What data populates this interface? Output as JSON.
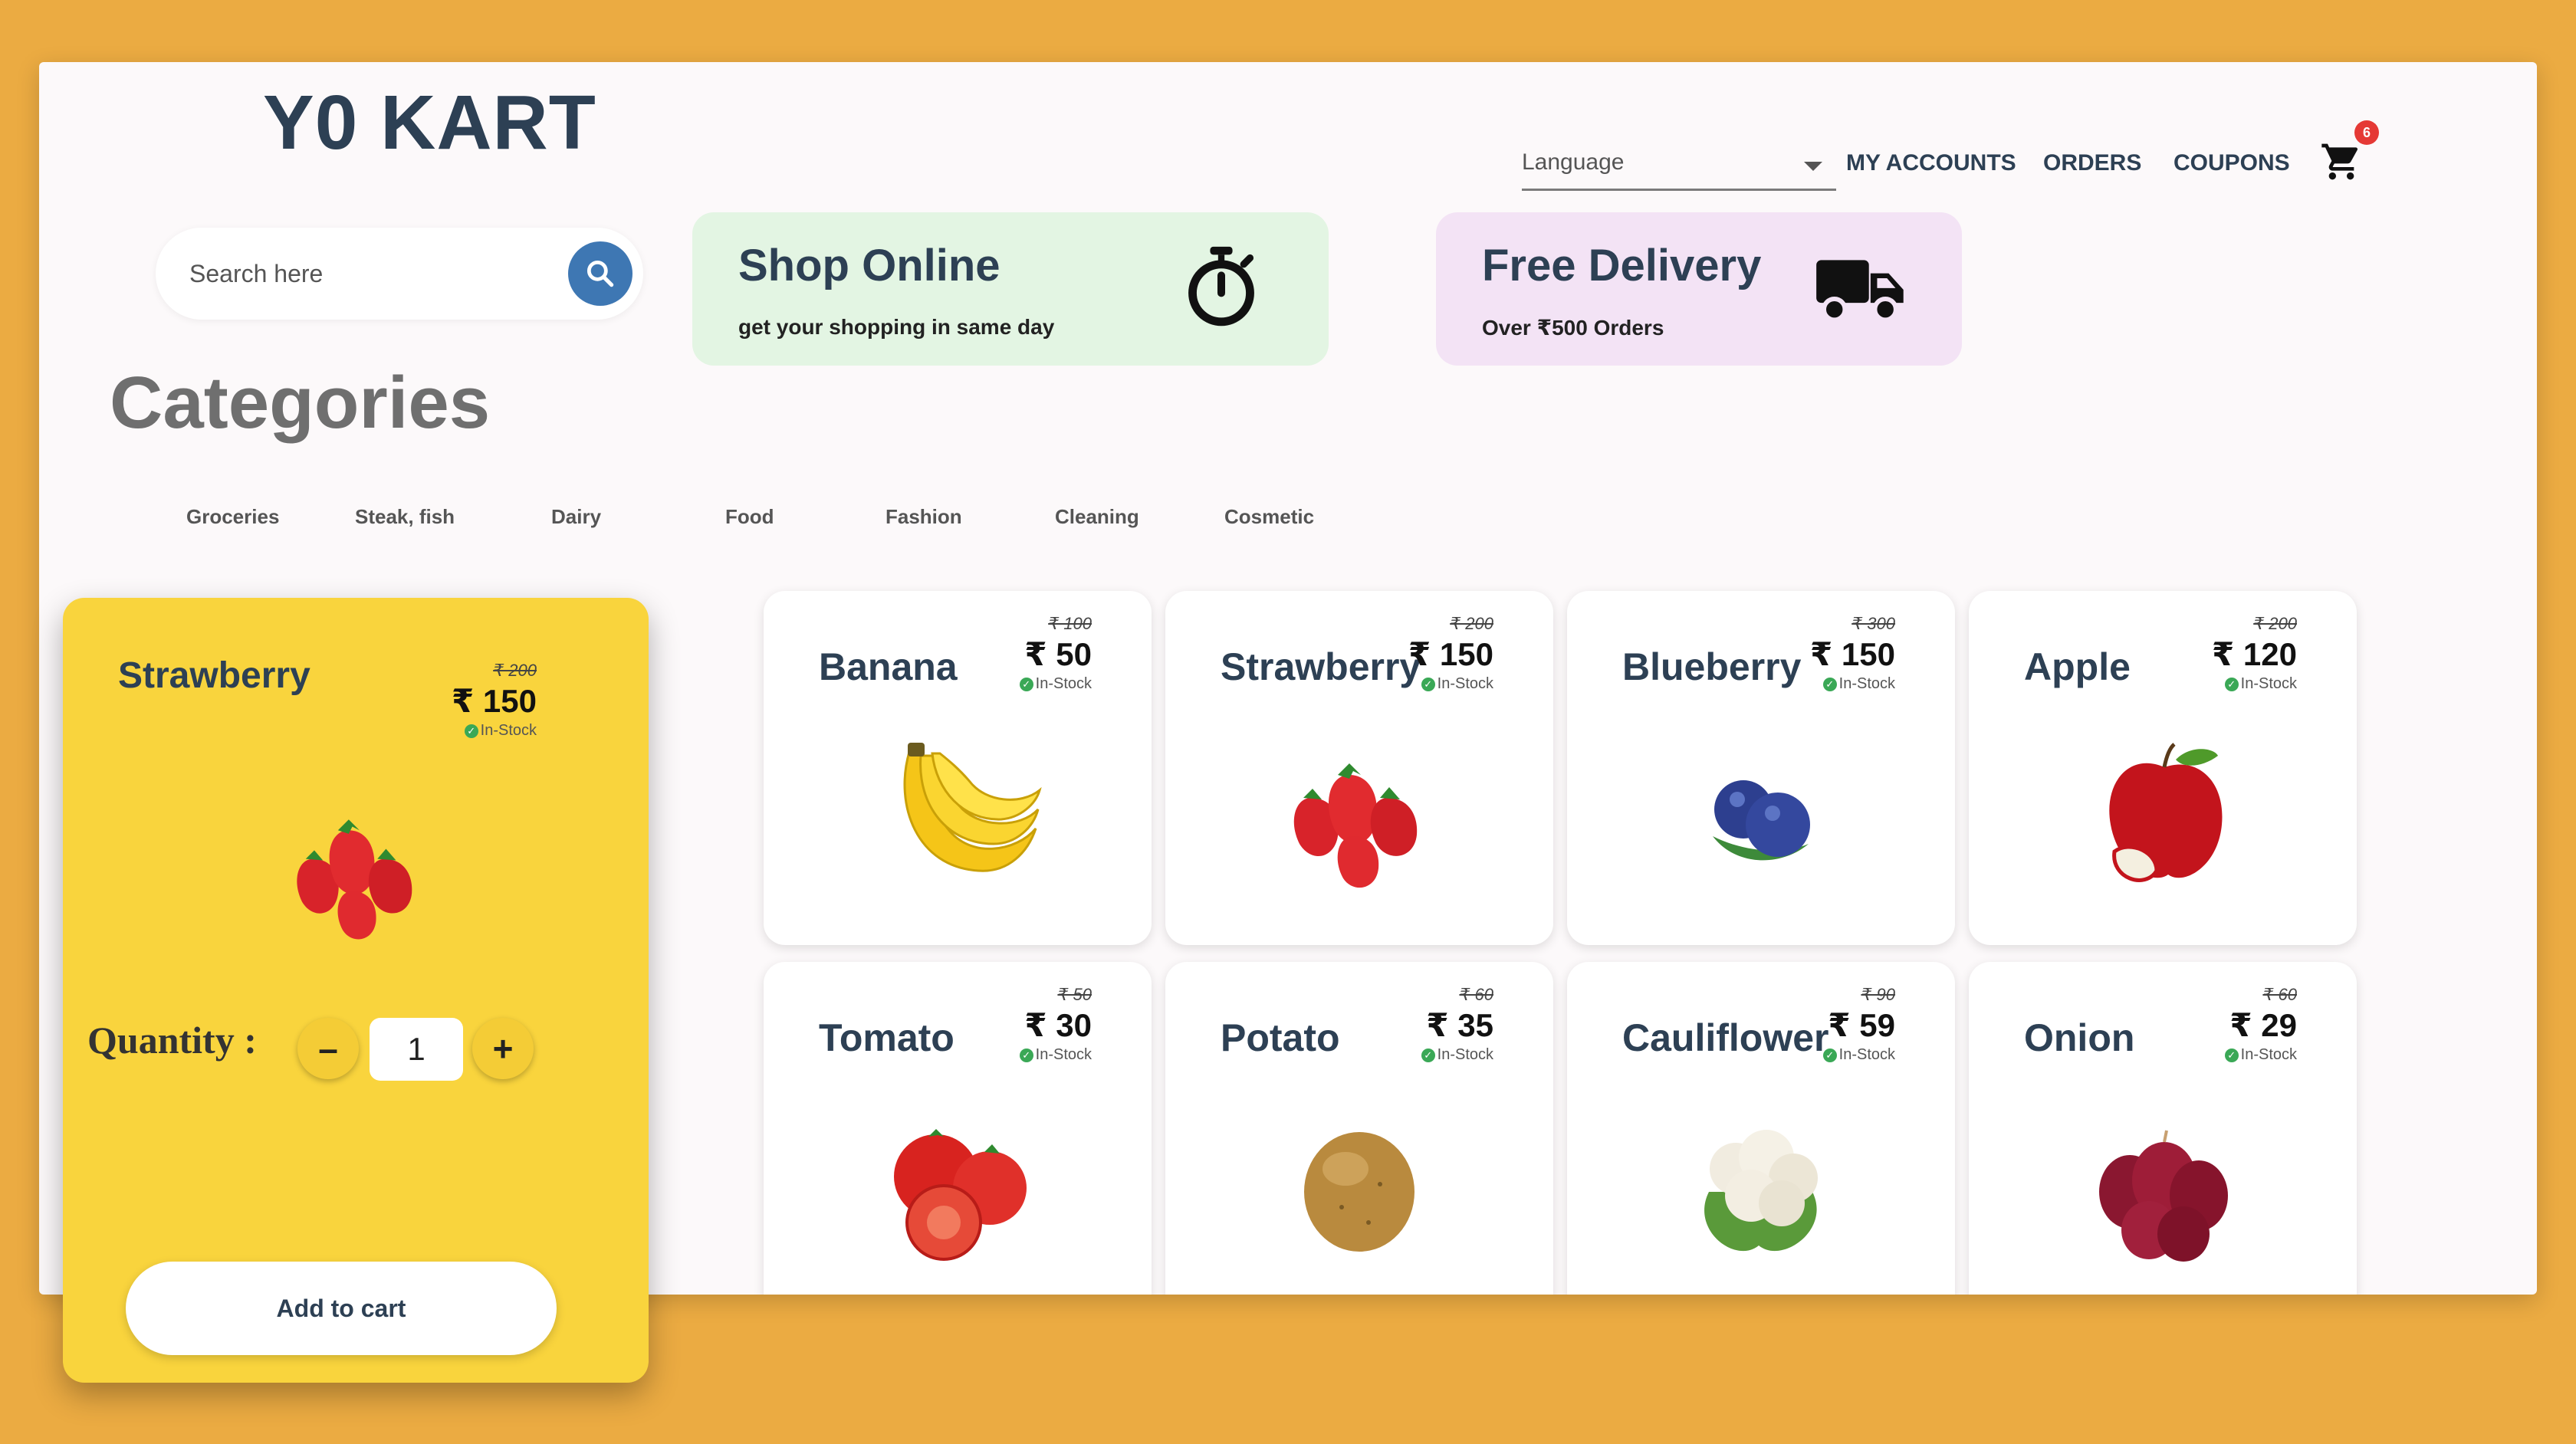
{
  "brand": {
    "logo": "Y0 KART"
  },
  "header": {
    "language_label": "Language",
    "nav": [
      "MY ACCOUNTS",
      "ORDERS",
      "COUPONS"
    ],
    "cart_count": "6"
  },
  "search": {
    "placeholder": "Search here"
  },
  "promos": [
    {
      "title": "Shop Online",
      "subtitle": "get your shopping in same day",
      "icon": "stopwatch-icon",
      "color": "#e3f5e3"
    },
    {
      "title": "Free Delivery",
      "subtitle": "Over ₹500 Orders",
      "icon": "truck-icon",
      "color": "#f3e3f5"
    }
  ],
  "categories": {
    "title": "Categories",
    "items": [
      "Groceries",
      "Steak, fish",
      "Dairy",
      "Food",
      "Fashion",
      "Cleaning",
      "Cosmetic"
    ]
  },
  "products": [
    {
      "name": "Banana",
      "old_price": "₹ 100",
      "price": "₹ 50",
      "stock": "In-Stock"
    },
    {
      "name": "Strawberry",
      "old_price": "₹ 200",
      "price": "₹ 150",
      "stock": "In-Stock"
    },
    {
      "name": "Blueberry",
      "old_price": "₹ 300",
      "price": "₹ 150",
      "stock": "In-Stock"
    },
    {
      "name": "Apple",
      "old_price": "₹ 200",
      "price": "₹ 120",
      "stock": "In-Stock"
    },
    {
      "name": "Tomato",
      "old_price": "₹ 50",
      "price": "₹ 30",
      "stock": "In-Stock"
    },
    {
      "name": "Potato",
      "old_price": "₹ 60",
      "price": "₹ 35",
      "stock": "In-Stock"
    },
    {
      "name": "Cauliflower",
      "old_price": "₹ 90",
      "price": "₹ 59",
      "stock": "In-Stock"
    },
    {
      "name": "Onion",
      "old_price": "₹ 60",
      "price": "₹ 29",
      "stock": "In-Stock"
    }
  ],
  "detail": {
    "name": "Strawberry",
    "old_price": "₹ 200",
    "price": "₹ 150",
    "stock": "In-Stock",
    "quantity_label": "Quantity :",
    "quantity": "1",
    "minus": "–",
    "plus": "+",
    "add_to_cart": "Add to cart"
  },
  "colors": {
    "background": "#ebab42",
    "accent": "#3e77b3",
    "detail_card": "#f9d43d",
    "text_dark": "#2d4054",
    "stock_green": "#3aa856",
    "cart_badge": "#e53935"
  }
}
